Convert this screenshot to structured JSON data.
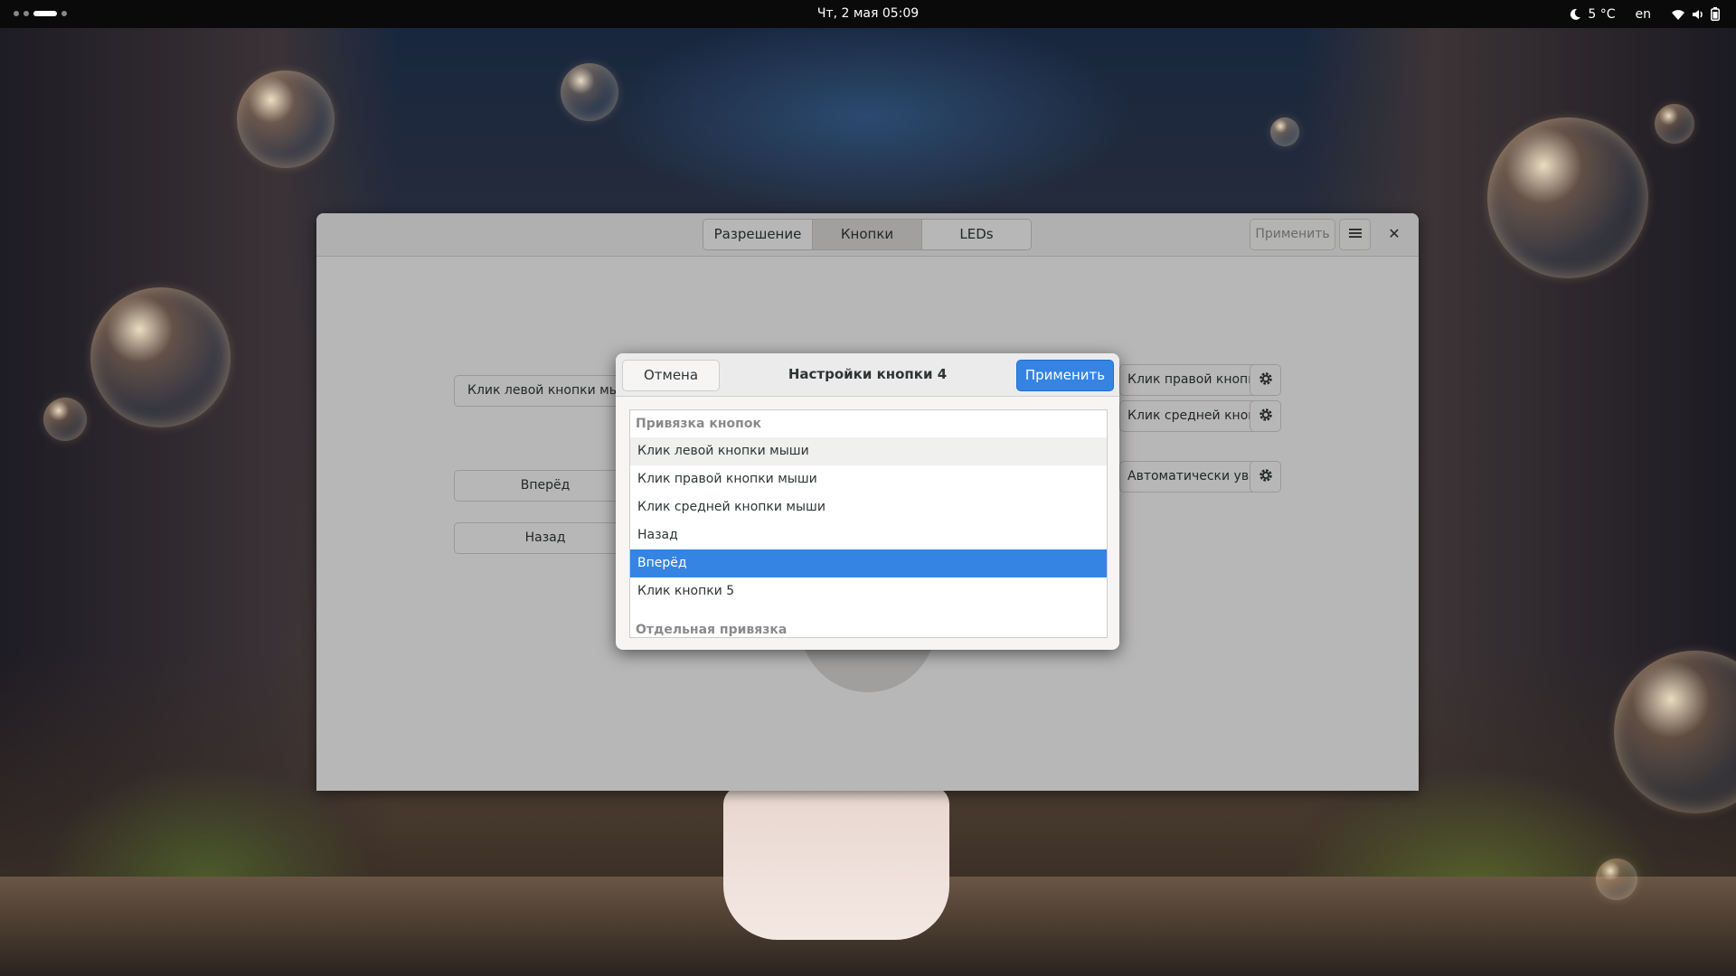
{
  "topbar": {
    "datetime": "Чт, 2 мая  05:09",
    "weather": "5 °C",
    "keyboard_layout": "en",
    "icons": [
      "night-moon-icon",
      "wifi-icon",
      "volume-icon",
      "battery-icon"
    ]
  },
  "main_window": {
    "tabs": [
      {
        "label": "Разрешение",
        "active": false
      },
      {
        "label": "Кнопки",
        "active": true
      },
      {
        "label": "LEDs",
        "active": false
      }
    ],
    "apply_label": "Применить",
    "left_buttons": [
      "Клик левой кнопки мыши",
      "Вперёд",
      "Назад"
    ],
    "right_buttons": [
      "Клик правой кнопки мыши",
      "Клик средней кнопки мыши",
      "Автоматически увеличить разрешение"
    ]
  },
  "dialog": {
    "title": "Настройки кнопки 4",
    "cancel_label": "Отмена",
    "apply_label": "Применить",
    "section_binding": "Привязка кнопок",
    "items": [
      {
        "label": "Клик левой кнопки мыши",
        "state": "hover"
      },
      {
        "label": "Клик правой кнопки мыши",
        "state": "normal"
      },
      {
        "label": "Клик средней кнопки мыши",
        "state": "normal"
      },
      {
        "label": "Назад",
        "state": "normal"
      },
      {
        "label": "Вперёд",
        "state": "selected"
      },
      {
        "label": "Клик кнопки 5",
        "state": "normal"
      }
    ],
    "section_separate": "Отдельная привязка"
  },
  "colors": {
    "accent": "#3584e4",
    "topbar": "#0a0a0a"
  }
}
